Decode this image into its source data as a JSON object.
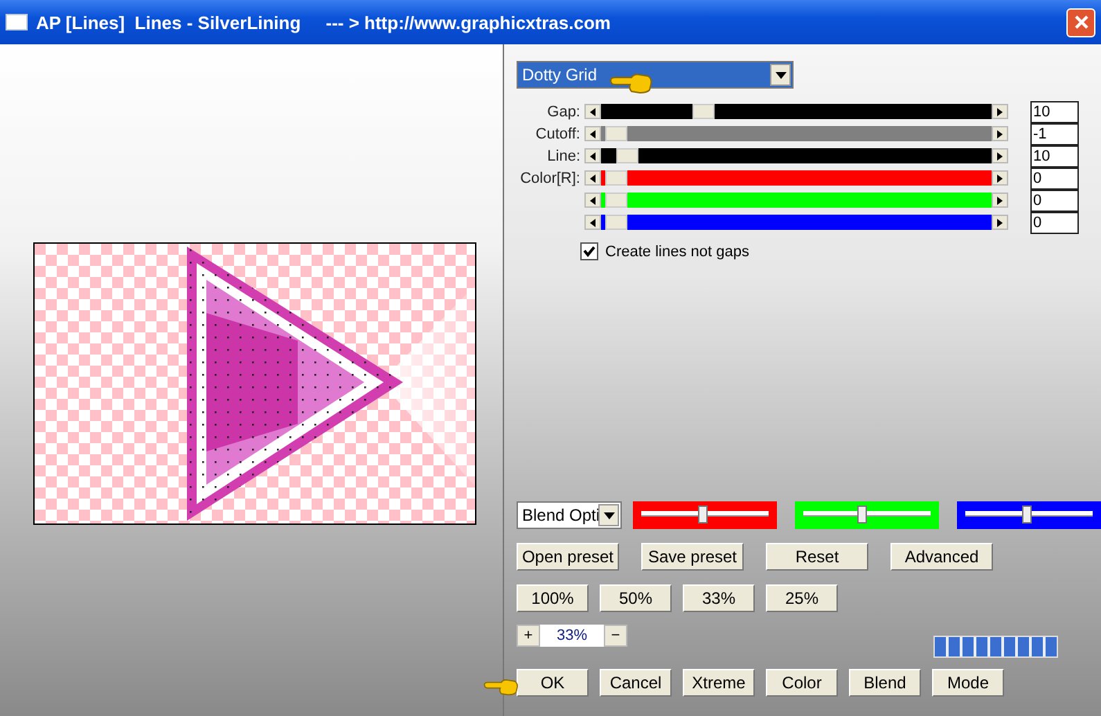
{
  "window": {
    "title": "AP [Lines]  Lines - SilverLining     --- > http://www.graphicxtras.com"
  },
  "preset": {
    "value": "Dotty Grid"
  },
  "sliders": [
    {
      "label": "Gap:",
      "level": 0.24,
      "color": "#000000",
      "value": "10"
    },
    {
      "label": "Cutoff:",
      "level": 0,
      "color": "#808080",
      "value": "-1"
    },
    {
      "label": "Line:",
      "level": 0.03,
      "color": "#000000",
      "value": "10"
    },
    {
      "label": "Color[R]:",
      "level": 0,
      "color": "#ff0000",
      "value": "0"
    },
    {
      "level": 0,
      "color": "#00ff00",
      "value": "0"
    },
    {
      "level": 0,
      "color": "#0000ff",
      "value": "0"
    }
  ],
  "checkbox": {
    "label": "Create lines not gaps",
    "checked": true
  },
  "blend": {
    "value": "Blend Opti"
  },
  "blend_sliders": [
    {
      "color": "#ff0000",
      "level": 0.5
    },
    {
      "color": "#00ff00",
      "level": 0.47
    },
    {
      "color": "#0000ff",
      "level": 0.5
    }
  ],
  "preset_buttons": [
    "Open preset",
    "Save preset",
    "Reset",
    "Advanced"
  ],
  "zoom_buttons": [
    "100%",
    "50%",
    "33%",
    "25%"
  ],
  "zoom": {
    "plus": "+",
    "value": "33%",
    "minus": "−"
  },
  "progress": {
    "level": 1
  },
  "buttons": [
    "OK",
    "Cancel",
    "Xtreme",
    "Color",
    "Blend",
    "Mode"
  ]
}
